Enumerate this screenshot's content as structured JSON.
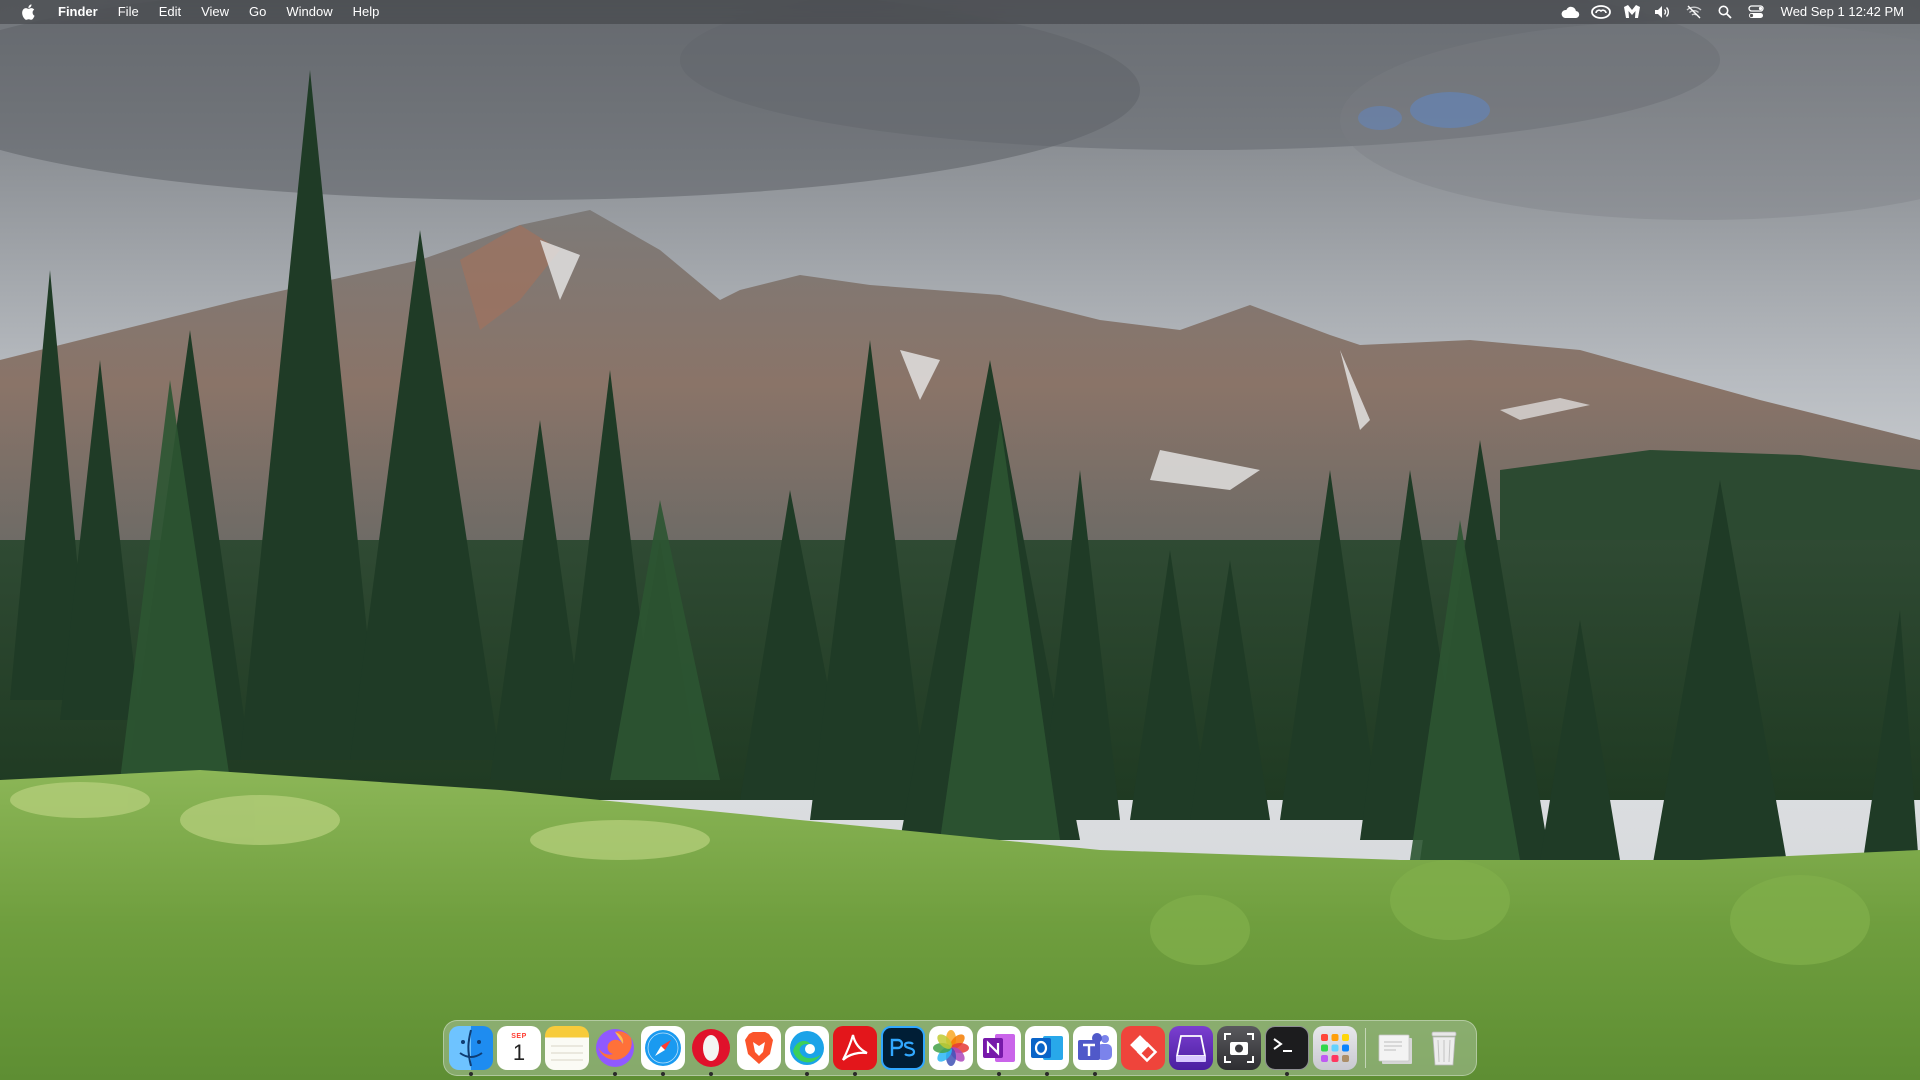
{
  "menubar": {
    "apple_icon": "apple-logo-icon",
    "app_name": "Finder",
    "menus": [
      "File",
      "Edit",
      "View",
      "Go",
      "Window",
      "Help"
    ],
    "status_icons": [
      {
        "name": "icloud-icon"
      },
      {
        "name": "creative-cloud-icon"
      },
      {
        "name": "mailbird-icon"
      },
      {
        "name": "volume-icon"
      },
      {
        "name": "wifi-off-icon"
      },
      {
        "name": "spotlight-search-icon"
      },
      {
        "name": "control-center-icon"
      }
    ],
    "clock": "Wed Sep 1  12:42 PM"
  },
  "calendar_tile": {
    "month": "SEP",
    "day": "1"
  },
  "dock": {
    "apps": [
      {
        "name": "finder",
        "label": "Finder",
        "running": true,
        "icon": "finder-icon"
      },
      {
        "name": "calendar",
        "label": "Calendar",
        "running": false,
        "icon": "calendar-icon"
      },
      {
        "name": "notes",
        "label": "Notes",
        "running": false,
        "icon": "notes-icon"
      },
      {
        "name": "firefox",
        "label": "Firefox",
        "running": true,
        "icon": "firefox-icon"
      },
      {
        "name": "safari",
        "label": "Safari",
        "running": true,
        "icon": "safari-icon"
      },
      {
        "name": "opera",
        "label": "Opera",
        "running": true,
        "icon": "opera-icon"
      },
      {
        "name": "brave",
        "label": "Brave",
        "running": false,
        "icon": "brave-icon"
      },
      {
        "name": "edge",
        "label": "Microsoft Edge",
        "running": true,
        "icon": "edge-icon"
      },
      {
        "name": "acrobat",
        "label": "Adobe Acrobat",
        "running": true,
        "icon": "acrobat-icon"
      },
      {
        "name": "photoshop",
        "label": "Photoshop",
        "running": false,
        "icon": "photoshop-icon"
      },
      {
        "name": "photos",
        "label": "Photos",
        "running": false,
        "icon": "photos-icon"
      },
      {
        "name": "onenote",
        "label": "OneNote",
        "running": true,
        "icon": "onenote-icon"
      },
      {
        "name": "outlook",
        "label": "Outlook",
        "running": true,
        "icon": "outlook-icon"
      },
      {
        "name": "teams",
        "label": "Teams",
        "running": true,
        "icon": "teams-icon"
      },
      {
        "name": "anydesk",
        "label": "AnyDesk",
        "running": false,
        "icon": "anydesk-icon"
      },
      {
        "name": "hard-drive",
        "label": "Disk Utility",
        "running": false,
        "icon": "hard-drive-icon"
      },
      {
        "name": "screenshot",
        "label": "Screenshot",
        "running": false,
        "icon": "screenshot-icon"
      },
      {
        "name": "terminal",
        "label": "Terminal",
        "running": true,
        "icon": "terminal-icon"
      },
      {
        "name": "launchpad",
        "label": "Launchpad",
        "running": false,
        "icon": "launchpad-icon"
      }
    ],
    "trailing": [
      {
        "name": "downloads-stack",
        "label": "Downloads",
        "icon": "document-stack-icon"
      },
      {
        "name": "trash",
        "label": "Trash",
        "icon": "trash-icon"
      }
    ]
  },
  "colors": {
    "menubar_text": "#ffffff",
    "finder_blue": "#1e8cf0",
    "acrobat_red": "#e3161b",
    "photoshop_navy": "#001e36",
    "onenote_purple": "#7719aa",
    "outlook_blue": "#0a64c8",
    "teams_purple": "#5059c9",
    "anydesk_red": "#ef443b",
    "opera_red": "#e0112b",
    "brave_orange": "#fb542b"
  }
}
